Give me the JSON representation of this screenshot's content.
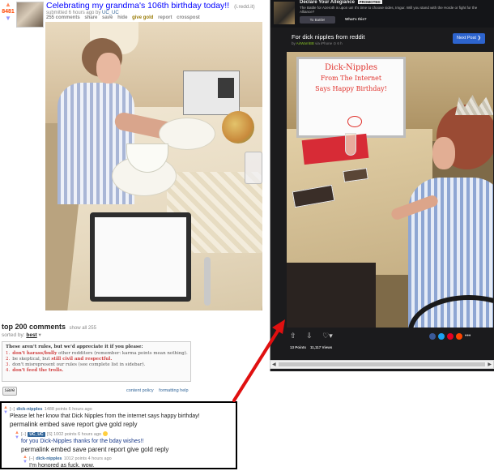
{
  "post": {
    "score": "8481",
    "upvote_glyph": "▲",
    "downvote_glyph": "▼",
    "title": "Celebrating my grandma's 106th birthday today!!",
    "domain": "(i.redd.it)",
    "tagline_prefix": "submitted 6 hours ago by",
    "author": "UC_UC",
    "buttons": [
      "255 comments",
      "share",
      "save",
      "hide",
      "give gold",
      "report",
      "crosspost"
    ]
  },
  "comments_area": {
    "heading": "top 200 comments",
    "show_all": "show all 255",
    "sort_label": "sorted by:",
    "sort_value": "best",
    "rules_title": "These aren't rules, but we'd appreciate it if you please:",
    "rules": [
      {
        "num": "1.",
        "pre": "",
        "hl": "don't harass/bully",
        "post": " other redditors (remember: karma points mean nothing)."
      },
      {
        "num": "2.",
        "pre": "be skeptical, but ",
        "hl": "still civil and respectful.",
        "post": ""
      },
      {
        "num": "3.",
        "pre": "don't misrepresent our rules (see complete list in sidebar).",
        "hl": "",
        "post": ""
      },
      {
        "num": "4.",
        "pre": "",
        "hl": "don't feed the trolls.",
        "post": ""
      }
    ],
    "save_button": "save",
    "links": [
      "content policy",
      "formatting help"
    ]
  },
  "comments": [
    {
      "collapse": "[–]",
      "author": "dick-nipples",
      "meta": "1488 points 6 hours ago",
      "body": "Please let her know that Dick Nipples from the internet says happy birthday!",
      "actions": [
        "permalink",
        "embed",
        "save",
        "report",
        "give gold",
        "reply"
      ]
    },
    {
      "collapse": "[–]",
      "author": "UC_UC",
      "meta": "[S] 1002 points 6 hours ago",
      "body": "for you Dick-Nipples thanks for the bday wishes!!",
      "actions": [
        "permalink",
        "embed",
        "save",
        "parent",
        "report",
        "give gold",
        "reply"
      ]
    },
    {
      "collapse": "[–]",
      "author": "dick-nipples",
      "meta": "1012 points 4 hours ago",
      "body": "I'm honored as fuck. wow.",
      "actions": []
    }
  ],
  "imgur": {
    "ad_title": "Declare Your Allegiance",
    "ad_badge": "PROMOTED",
    "ad_text": "The Battle for Azeroth is upon us! It's time to choose sides, Imgur. Will you stand with the Horde or fight for the Alliance?",
    "ad_button": "To Battle!",
    "ad_link": "What's this?",
    "post_title": "For dick nipples from reddit",
    "post_meta_prefix": "by",
    "post_author": "AirWarriBB",
    "post_meta_suffix": "via iPhone ⊙ 6 h",
    "next_button": "Next Post  ❯",
    "whiteboard_lines": [
      "Dick-Nipples",
      "From The Internet",
      "Says Happy Birthday!"
    ],
    "points": "13 Points",
    "views": "11,117 Views",
    "action_icons": [
      "⇧",
      "⇩",
      "♡▾"
    ],
    "share_colors": [
      "#3b5998",
      "#1da1f2",
      "#e60023",
      "#ff4500"
    ],
    "share_more": "•••",
    "scroll_left": "◀",
    "scroll_right": "▶"
  },
  "colors": {
    "link_blue": "#0000ff",
    "score_orange": "#ff4500",
    "imgur_bg": "#1b1b1d",
    "next_button_blue": "#2d64ce",
    "arrow_red": "#e01010"
  }
}
